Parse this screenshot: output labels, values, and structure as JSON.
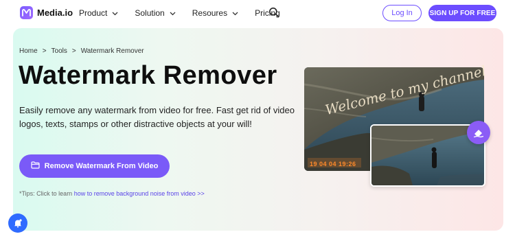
{
  "header": {
    "brand": "Media.io",
    "menu": [
      {
        "label": "Product",
        "has_dropdown": true
      },
      {
        "label": "Solution",
        "has_dropdown": true
      },
      {
        "label": "Resoures",
        "has_dropdown": true
      },
      {
        "label": "Pricing",
        "has_dropdown": false
      }
    ],
    "login_label": "Log In",
    "signup_label": "SIGN UP FOR FREE",
    "search_icon": "search-icon"
  },
  "hero": {
    "breadcrumb": [
      "Home",
      ">",
      "Tools",
      ">",
      "Watermark Remover"
    ],
    "title": "Watermark Remover",
    "description": "Easily remove any watermark from video for free. Fast get rid of video logos, texts, stamps or other distractive objects at your will!",
    "cta_label": "Remove Watermark From Video",
    "tips_prefix": "*Tips: Click to learn ",
    "tips_link": "how to remove background noise from video >>",
    "watermark_text": "Welcome to my channel",
    "timestamp_text": "19 04 04 19:26"
  },
  "colors": {
    "accent": "#6c4dff",
    "cta": "#7a5af8",
    "eraser_badge": "#8b5cf6",
    "helper_button": "#2f6bff"
  }
}
